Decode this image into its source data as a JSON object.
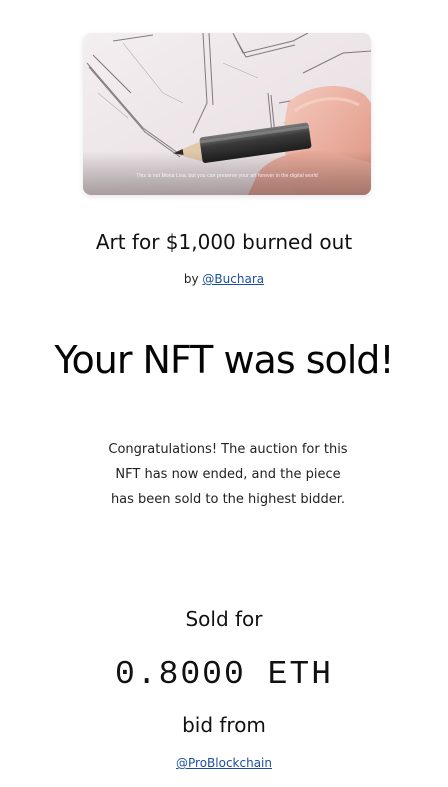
{
  "artwork": {
    "caption": "This is not Mona Lisa, but you can preserve your art forever in the digital world"
  },
  "nft": {
    "title": "Art for $1,000 burned out",
    "by_prefix": "by",
    "artist": "@Buchara"
  },
  "status": {
    "headline": "Your NFT was sold!",
    "message": "Congratulations! The auction for this NFT has now ended, and the piece has been sold to the highest bidder."
  },
  "sale": {
    "sold_label": "Sold for",
    "price": "0.8000 ETH",
    "bid_label": "bid from",
    "bidder": "@ProBlockchain"
  },
  "colors": {
    "link": "#1e4ea0",
    "text": "#111111",
    "background": "#ffffff"
  }
}
